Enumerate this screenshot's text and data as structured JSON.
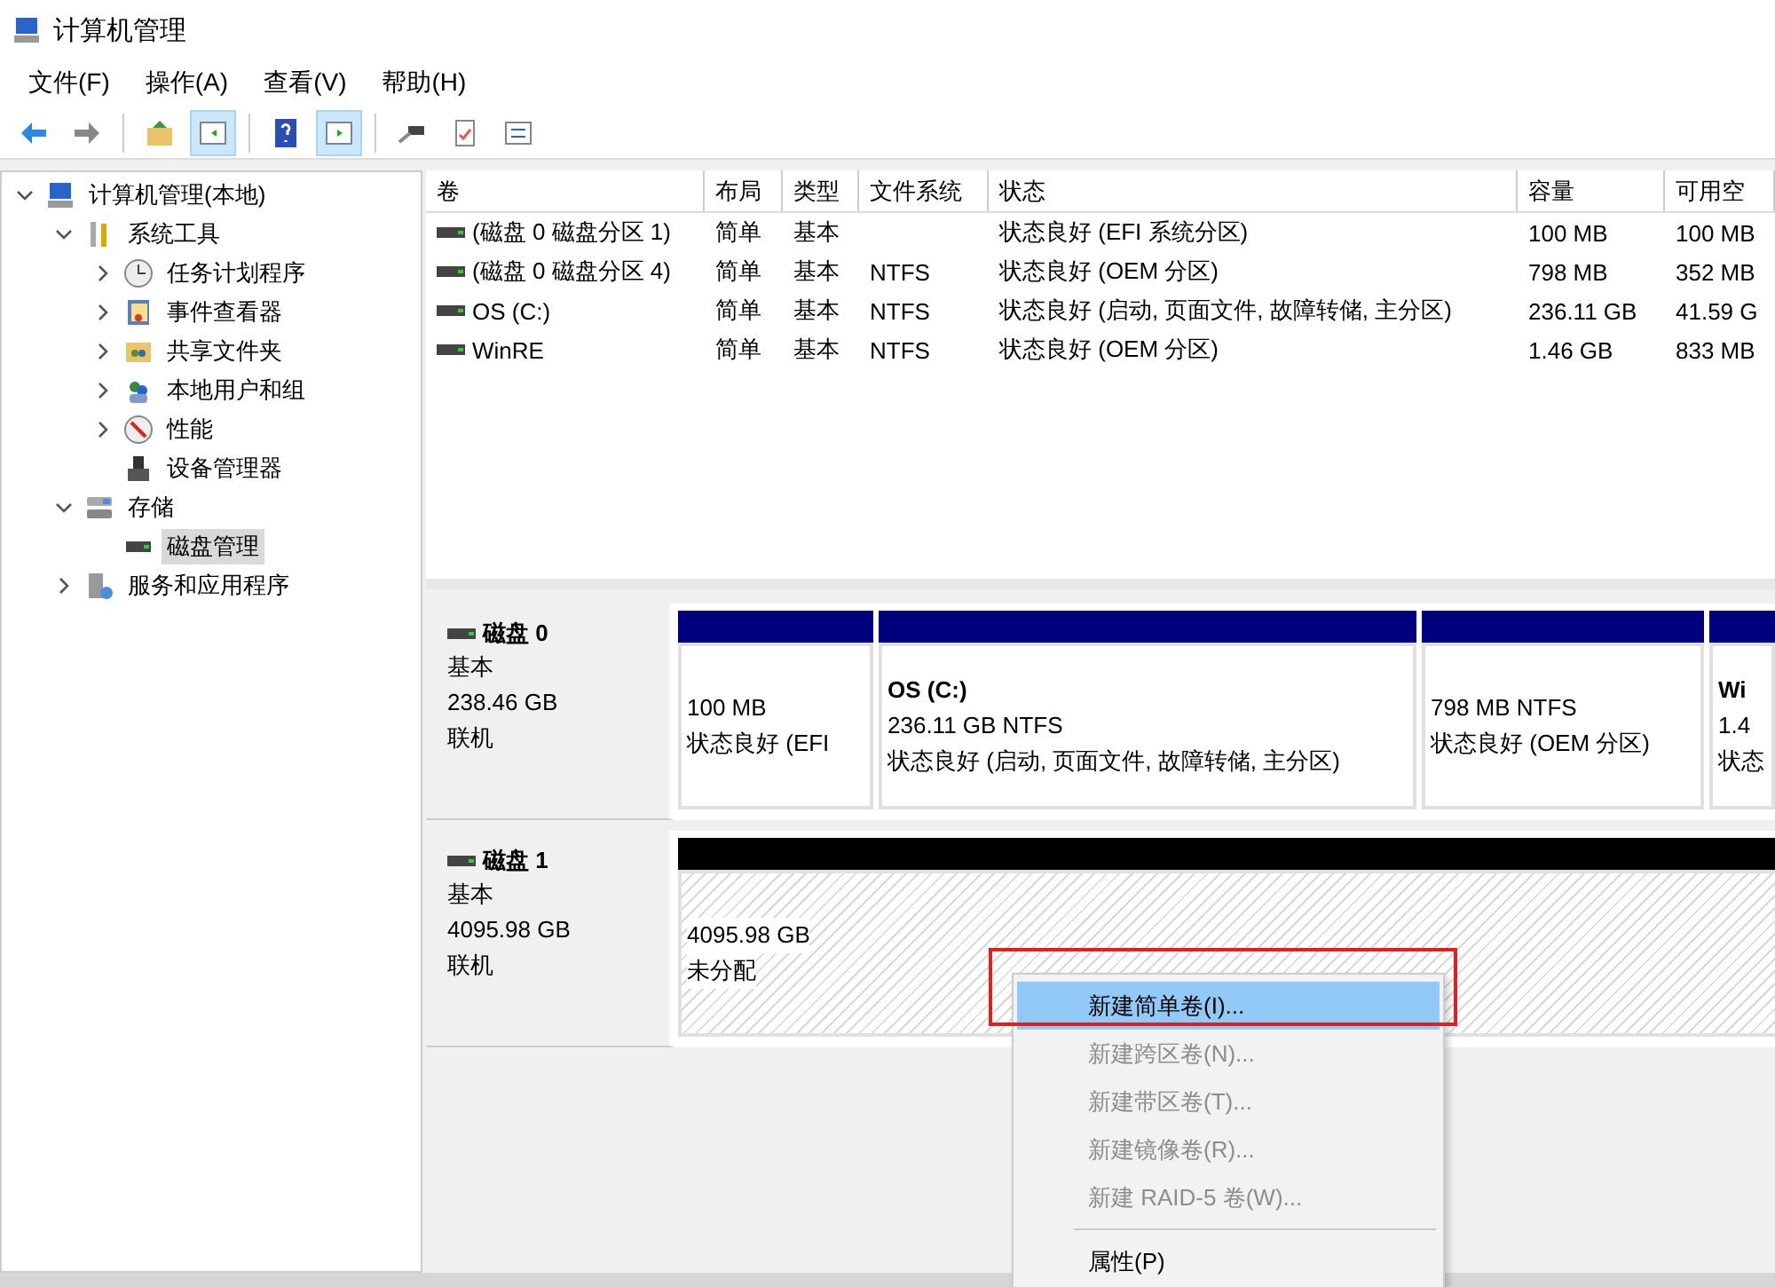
{
  "window": {
    "title": "计算机管理"
  },
  "menu": [
    "文件(F)",
    "操作(A)",
    "查看(V)",
    "帮助(H)"
  ],
  "toolbar": [
    {
      "kind": "back",
      "pressed": false
    },
    {
      "kind": "forward",
      "pressed": false
    },
    {
      "kind": "sep"
    },
    {
      "kind": "up",
      "pressed": false
    },
    {
      "kind": "pane-left",
      "pressed": true
    },
    {
      "kind": "sep"
    },
    {
      "kind": "help",
      "pressed": false
    },
    {
      "kind": "pane-right",
      "pressed": true
    },
    {
      "kind": "sep"
    },
    {
      "kind": "connect",
      "pressed": false
    },
    {
      "kind": "check",
      "pressed": false
    },
    {
      "kind": "list",
      "pressed": false
    }
  ],
  "tree": [
    {
      "label": "计算机管理(本地)",
      "kind": "computer",
      "expanded": true,
      "selected": false,
      "children": [
        {
          "label": "系统工具",
          "kind": "tools",
          "expanded": true,
          "selected": false,
          "children": [
            {
              "label": "任务计划程序",
              "kind": "clock",
              "expanded": false,
              "selected": false
            },
            {
              "label": "事件查看器",
              "kind": "log",
              "expanded": false,
              "selected": false
            },
            {
              "label": "共享文件夹",
              "kind": "folder",
              "expanded": false,
              "selected": false
            },
            {
              "label": "本地用户和组",
              "kind": "users",
              "expanded": false,
              "selected": false
            },
            {
              "label": "性能",
              "kind": "gauge",
              "expanded": false,
              "selected": false
            },
            {
              "label": "设备管理器",
              "kind": "device",
              "selected": false
            }
          ]
        },
        {
          "label": "存储",
          "kind": "storage",
          "expanded": true,
          "selected": false,
          "children": [
            {
              "label": "磁盘管理",
              "kind": "disk",
              "selected": true
            }
          ]
        },
        {
          "label": "服务和应用程序",
          "kind": "services",
          "expanded": false,
          "selected": false
        }
      ]
    }
  ],
  "volumes": {
    "columns": [
      "卷",
      "布局",
      "类型",
      "文件系统",
      "状态",
      "容量",
      "可用空"
    ],
    "rows": [
      [
        "(磁盘 0 磁盘分区 1)",
        "简单",
        "基本",
        "",
        "状态良好 (EFI 系统分区)",
        "100 MB",
        "100 MB"
      ],
      [
        "(磁盘 0 磁盘分区 4)",
        "简单",
        "基本",
        "NTFS",
        "状态良好 (OEM 分区)",
        "798 MB",
        "352 MB"
      ],
      [
        "OS (C:)",
        "简单",
        "基本",
        "NTFS",
        "状态良好 (启动, 页面文件, 故障转储, 主分区)",
        "236.11 GB",
        "41.59 G"
      ],
      [
        "WinRE",
        "简单",
        "基本",
        "NTFS",
        "状态良好 (OEM 分区)",
        "1.46 GB",
        "833 MB"
      ]
    ]
  },
  "disks": [
    {
      "name": "磁盘 0",
      "type": "基本",
      "size": "238.46 GB",
      "status": "联机",
      "partitions": [
        {
          "kind": "primary",
          "lines": [
            "100 MB",
            "状态良好 (EFI"
          ]
        },
        {
          "kind": "primary",
          "title": "OS  (C:)",
          "lines": [
            "236.11 GB NTFS",
            "状态良好 (启动, 页面文件, 故障转储, 主分区)"
          ]
        },
        {
          "kind": "primary",
          "lines": [
            "798 MB NTFS",
            "状态良好 (OEM 分区)"
          ]
        },
        {
          "kind": "primary",
          "title": "Wi",
          "lines": [
            "1.4",
            "状态"
          ]
        }
      ]
    },
    {
      "name": "磁盘 1",
      "type": "基本",
      "size": "4095.98 GB",
      "status": "联机",
      "partitions": [
        {
          "kind": "unallocated",
          "lines": [
            "4095.98 GB",
            "未分配"
          ]
        }
      ]
    }
  ],
  "context_menu": {
    "items": [
      {
        "label": "新建简单卷(I)...",
        "kind": "item",
        "disabled": false,
        "selected": true
      },
      {
        "label": "新建跨区卷(N)...",
        "kind": "item",
        "disabled": true,
        "selected": false
      },
      {
        "label": "新建带区卷(T)...",
        "kind": "item",
        "disabled": true,
        "selected": false
      },
      {
        "label": "新建镜像卷(R)...",
        "kind": "item",
        "disabled": true,
        "selected": false
      },
      {
        "label": "新建 RAID-5 卷(W)...",
        "kind": "item",
        "disabled": true,
        "selected": false
      },
      {
        "kind": "separator"
      },
      {
        "label": "属性(P)",
        "kind": "item",
        "disabled": false,
        "selected": false
      }
    ]
  },
  "highlight": {
    "color": "#e02020"
  }
}
